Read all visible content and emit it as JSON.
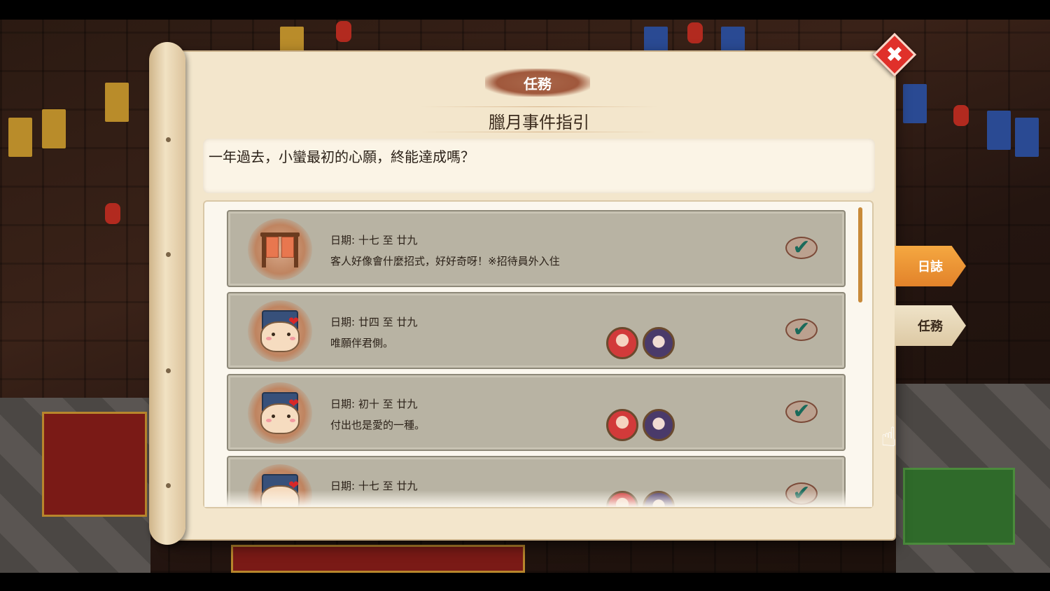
{
  "panel": {
    "header": "任務",
    "subtitle": "臘月事件指引",
    "description": "一年過去，小蠻最初的心願，終能達成嗎？"
  },
  "tasks": [
    {
      "date": "日期: 十七 至 廿九",
      "desc": "客人好像會什麼招式，好好奇呀！※招待員外入住",
      "icon": "curtain-icon",
      "completed": true,
      "avatars": []
    },
    {
      "date": "日期: 廿四 至 廿九",
      "desc": "唯願伴君側。",
      "icon": "bun-hat-heart-icon",
      "completed": true,
      "avatars": [
        "red-hair-girl-avatar",
        "purple-hair-girl-avatar"
      ]
    },
    {
      "date": "日期: 初十 至 廿九",
      "desc": "付出也是愛的一種。",
      "icon": "bun-hat-heart-icon",
      "completed": true,
      "avatars": [
        "red-hair-girl-avatar",
        "purple-hair-girl-avatar"
      ]
    },
    {
      "date": "日期: 十七 至 廿九",
      "desc": "",
      "icon": "bun-hat-heart-icon",
      "completed": true,
      "avatars": [
        "avatar",
        "avatar"
      ]
    }
  ],
  "tabs": [
    {
      "label": "日誌",
      "active": true
    },
    {
      "label": "任務",
      "active": false
    }
  ],
  "close": {
    "label": "✖"
  },
  "colors": {
    "accent": "#e2822a",
    "close": "#e0302a",
    "card": "#b8b3a3",
    "check": "#1a6a5a"
  }
}
